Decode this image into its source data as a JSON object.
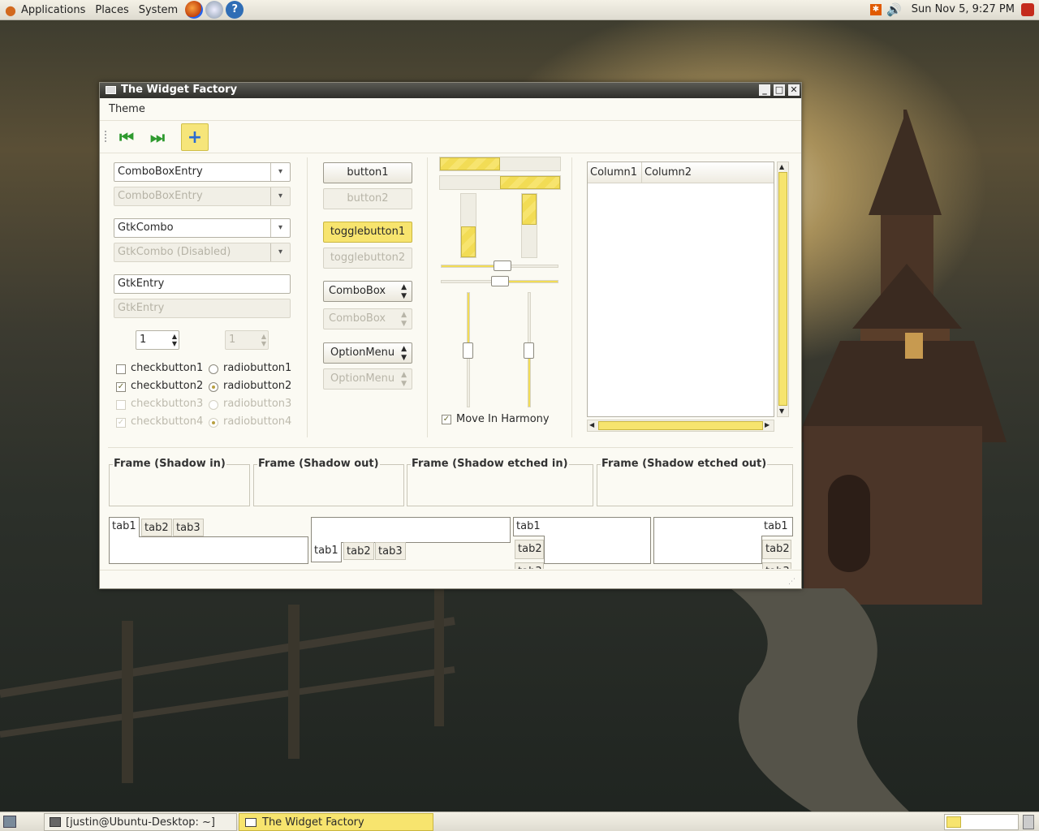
{
  "top_panel": {
    "menus": [
      "Applications",
      "Places",
      "System"
    ],
    "clock": "Sun Nov  5,  9:27 PM"
  },
  "window": {
    "title": "The Widget Factory",
    "menubar": {
      "theme": "Theme"
    },
    "combos": {
      "cbe1": "ComboBoxEntry",
      "cbe2": "ComboBoxEntry",
      "gc1": "GtkCombo",
      "gc2": "GtkCombo (Disabled)"
    },
    "entries": {
      "e1": "GtkEntry",
      "e2": "GtkEntry"
    },
    "spins": {
      "s1": "1",
      "s2": "1"
    },
    "checks": [
      "checkbutton1",
      "checkbutton2",
      "checkbutton3",
      "checkbutton4"
    ],
    "radios": [
      "radiobutton1",
      "radiobutton2",
      "radiobutton3",
      "radiobutton4"
    ],
    "buttons": {
      "b1": "button1",
      "b2": "button2",
      "t1": "togglebutton1",
      "t2": "togglebutton2",
      "c1": "ComboBox",
      "c2": "ComboBox",
      "o1": "OptionMenu",
      "o2": "OptionMenu"
    },
    "move_in_harmony": "Move In Harmony",
    "tree": {
      "col1": "Column1",
      "col2": "Column2"
    },
    "frames": [
      "Frame (Shadow in)",
      "Frame (Shadow out)",
      "Frame (Shadow etched in)",
      "Frame (Shadow etched out)"
    ],
    "tabs": [
      "tab1",
      "tab2",
      "tab3"
    ],
    "progress": {
      "h1": 0.48,
      "h2": 0.48,
      "v1": 0.48,
      "v2": 0.48
    }
  },
  "taskbar": {
    "items": [
      "[justin@Ubuntu-Desktop: ~]",
      "The Widget Factory"
    ]
  },
  "colors": {
    "accent": "#f7e46e",
    "panel": "#e8e5da"
  }
}
